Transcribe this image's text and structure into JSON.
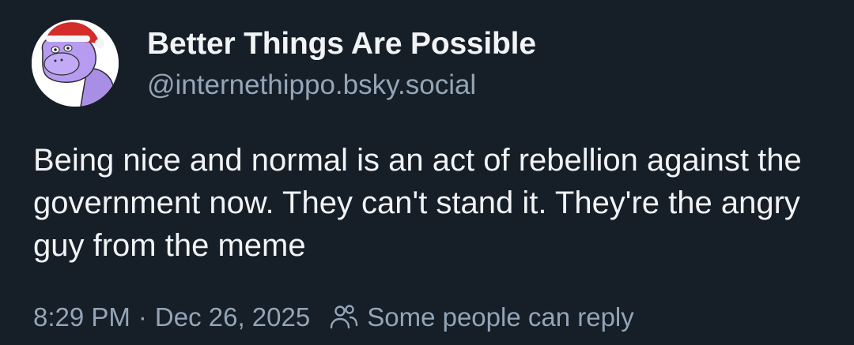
{
  "post": {
    "display_name": "Better Things Are Possible",
    "handle": "@internethippo.bsky.social",
    "text": "Being nice and normal is an act of rebellion against the government now. They can't stand it. They're the angry guy from the meme",
    "time": "8:29 PM",
    "separator": "·",
    "date": "Dec 26, 2025",
    "reply_setting": "Some people can reply"
  },
  "icons": {
    "avatar": "purple-hippo-santa-hat-avatar",
    "reply": "people-icon"
  },
  "colors": {
    "background": "#161e27",
    "primary_text": "#f1f3f5",
    "secondary_text": "#93a5b7",
    "avatar_hippo": "#a98ee6",
    "santa_hat": "#d42b2b"
  }
}
